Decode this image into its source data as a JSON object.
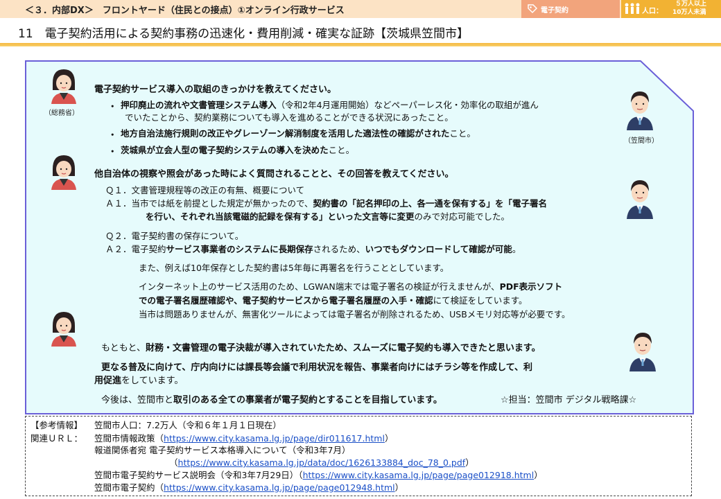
{
  "header": {
    "section": "＜３．内部DX＞　フロントヤード（住民との接点）①オンライン行政サービス",
    "tag_label": "電子契約",
    "population_label": "人口：",
    "population_value_line1": "５万人以上",
    "population_value_line2": "10万人未満",
    "tag_icon": "tag-icon",
    "people_icon": "people-icon"
  },
  "title": "11　電子契約活用による契約事務の迅速化・費用削減・確実な証跡【茨城県笠間市】",
  "colors": {
    "panel_bg": "#e6fbfc",
    "panel_border": "#6a5fd8",
    "accent_orange": "#f2a47c",
    "accent_yellow": "#f2b233",
    "link": "#1a4fc7"
  },
  "speakers": {
    "ministry": "（総務省）",
    "city": "（笠間市）"
  },
  "q1": {
    "heading": "電子契約サービス導入の取組のきっかけを教えてください。",
    "b1a_bold": "押印廃止の流れや文書管理システム導入",
    "b1a_rest": "（令和2年4月運用開始）などペーパーレス化・効率化の取組が進ん",
    "b1b": "でいたことから、契約業務についても導入を進めることができる状況にあったこと。",
    "b2_bold": "地方自治法施行規則の改正やグレーゾーン解消制度を活用した適法性の確認がされた",
    "b2_rest": "こと。",
    "b3_bold": "茨城県が立会人型の電子契約システムの導入を決めた",
    "b3_rest": "こと。"
  },
  "q2": {
    "heading": "他自治体の視察や照会があった時によく質問されることと、その回答を教えてください。",
    "q1_line": "Ｑ１．文書管理規程等の改正の有無、概要について",
    "a1_pre": "Ａ１．当市では紙を前提とした規定が無かったので、",
    "a1_bold": "契約書の「記名押印の上、各一通を保有する」を「電子署名",
    "a1b_bold": "を行い、それぞれ当該電磁的記録を保有する」といった文言等に変更",
    "a1b_rest": "のみで対応可能でした。",
    "q2_line": "Ｑ２．電子契約書の保存について。",
    "a2_pre": "Ａ２．電子契約",
    "a2_bold1": "サービス事業者のシステムに長期保存",
    "a2_mid": "されるため、",
    "a2_bold2": "いつでもダウンロードして確認が可能",
    "a2_end": "。",
    "a2c": "また、例えば10年保存とした契約書は5年毎に再署名を行うこととしています。",
    "a2d_pre": "インターネット上のサービス活用のため、LGWAN端末では電子署名の検証が行えませんが、",
    "a2d_bold": "PDF表示ソフト",
    "a2e_bold": "での電子署名履歴確認や、電子契約サービスから電子署名履歴の入手・確認",
    "a2e_rest": "にて検証をしています。",
    "a2f": "当市は問題ありませんが、無害化ツールによっては電子署名が削除されるため、USBメモリ対応等が必要です。"
  },
  "closing": {
    "c1_pre": "もともと、",
    "c1_bold": "財務・文書管理の電子決裁が導入されていたため、スムーズに電子契約も導入できたと思います。",
    "c2_bold": "更なる普及に向けて、庁内向けには課長等会議で利用状況を報告、事業者向けにはチラシ等を作成して、利",
    "c3_bold": "用促進",
    "c3_rest": "をしています。",
    "c4_pre": "今後は、笠間市と",
    "c4_bold": "取引のある全ての事業者が電子契約とすることを目指しています。",
    "contact": "☆担当：笠間市 デジタル戦略課☆"
  },
  "reference": {
    "label": "【参考情報】",
    "population": "笠間市人口：7.2万人（令和６年１月１日現在）",
    "url_label": "関連ＵＲＬ：",
    "r1_text": "笠間市情報政策（",
    "r1_url": "https://www.city.kasama.lg.jp/page/dir011617.html",
    "r2_text": "報道関係者宛 電子契約サービス本格導入について（令和3年7月）",
    "r3_url": "https://www.city.kasama.lg.jp/data/doc/1626133884_doc_78_0.pdf",
    "r4_text": "笠間市電子契約サービス説明会（令和3年7月29日）（",
    "r4_url": "https://www.city.kasama.lg.jp/page/page012918.html",
    "r5_text": "笠間市電子契約（",
    "r5_url": "https://www.city.kasama.lg.jp/page/page012948.html",
    "paren_open": "（",
    "paren_close": "）"
  }
}
